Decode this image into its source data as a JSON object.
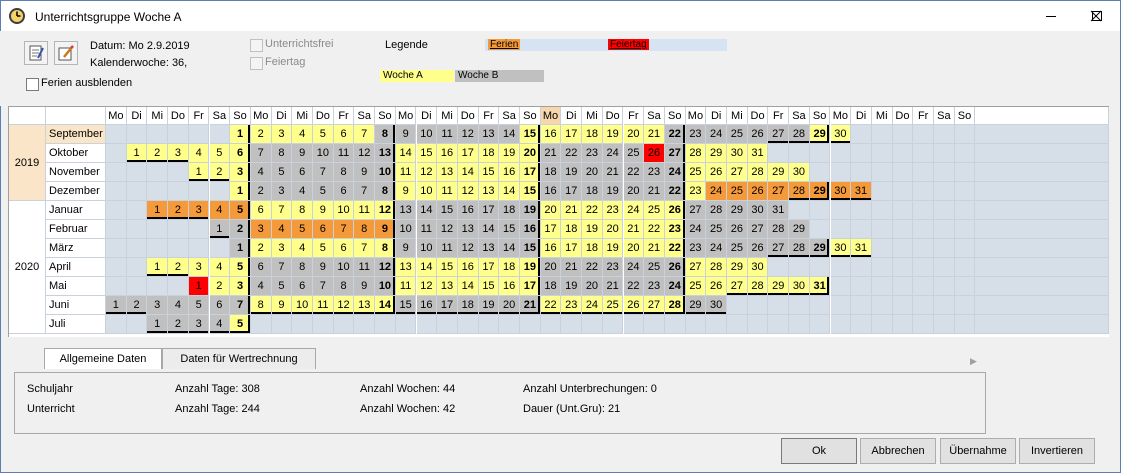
{
  "window": {
    "title": "Unterrichtsgruppe Woche A"
  },
  "header": {
    "date_label": "Datum: Mo 2.9.2019",
    "week_label": "Kalenderwoche: 36,",
    "hide_holidays_label": "Ferien ausblenden",
    "no_class_label": "Unterrichtsfrei",
    "holiday_label": "Feiertag",
    "legend_label": "Legende",
    "legend_ferien": "Ferien",
    "legend_feiertag": "Feiertag",
    "legend_woche_a": "Woche A",
    "legend_woche_b": "Woche B"
  },
  "calendar": {
    "day_headers": [
      "Mo",
      "Di",
      "Mi",
      "Do",
      "Fr",
      "Sa",
      "So",
      "Mo",
      "Di",
      "Mi",
      "Do",
      "Fr",
      "Sa",
      "So",
      "Mo",
      "Di",
      "Mi",
      "Do",
      "Fr",
      "Sa",
      "So",
      "Mo",
      "Di",
      "Mi",
      "Do",
      "Fr",
      "Sa",
      "So",
      "Mo",
      "Di",
      "Mi",
      "Do",
      "Fr",
      "Sa",
      "So",
      "Mo",
      "Di",
      "Mi",
      "Do",
      "Fr",
      "Sa",
      "So"
    ],
    "years": [
      {
        "label": "2019",
        "span": 4
      },
      {
        "label": "2020",
        "span": 7
      }
    ],
    "months": [
      {
        "name": "September",
        "start": 6,
        "days": 30,
        "types": "YYYYYYYGGGGGGGYYYYYYYGGGGGGGYY"
      },
      {
        "name": "Oktober",
        "start": 1,
        "days": 31,
        "types": "YYYYYYGGGGGGGYYYYYYYGGGGGFGYYYY"
      },
      {
        "name": "November",
        "start": 4,
        "days": 30,
        "types": "YYYGGGGGGGYYYYYYYGGGGGGGYYYYYY"
      },
      {
        "name": "Dezember",
        "start": 6,
        "days": 31,
        "types": "YGGGGGGGYYYYYYYGGGGGGGYOOOOOOOO"
      },
      {
        "name": "Januar",
        "start": 2,
        "days": 31,
        "types": "OOOOOYYYYYYYGGGGGGGYYYYYYYGGGGG"
      },
      {
        "name": "Februar",
        "start": 5,
        "days": 29,
        "types": "GGOOOOOOOGGGGGGGYYYYYYYGGGGGG"
      },
      {
        "name": "März",
        "start": 6,
        "days": 31,
        "types": "GYYYYYYYGGGGGGGYYYYYYYGGGGGGGYY"
      },
      {
        "name": "April",
        "start": 2,
        "days": 30,
        "types": "YYYYYGGGGGGGYYYYYYYGGGGGGGYYYY"
      },
      {
        "name": "Mai",
        "start": 4,
        "days": 31,
        "types": "FYYGGGGGGGYYYYYYYGGGGGGGYYYYYYY"
      },
      {
        "name": "Juni",
        "start": 0,
        "days": 30,
        "types": "GGGGGGGYYYYYYYGGGGGGGYYYYYYYGG"
      },
      {
        "name": "Juli",
        "start": 2,
        "days": 5,
        "types": "GGGGY"
      }
    ]
  },
  "tabs": [
    {
      "label": "Allgemeine Daten"
    },
    {
      "label": "Daten für Wertrechnung"
    }
  ],
  "stats": {
    "row1": {
      "name": "Schuljahr",
      "tage": "Anzahl Tage: 308",
      "wochen": "Anzahl Wochen: 44",
      "extra": "Anzahl Unterbrechungen: 0"
    },
    "row2": {
      "name": "Unterricht",
      "tage": "Anzahl Tage: 244",
      "wochen": "Anzahl Wochen: 42",
      "extra": "Dauer (Unt.Gru): 21"
    }
  },
  "buttons": {
    "ok": "Ok",
    "cancel": "Abbrechen",
    "apply": "Übernahme",
    "invert": "Invertieren"
  },
  "colors": {
    "woche_a": "#ffff8c",
    "woche_b": "#c0c0c0",
    "ferien": "#f59a3a",
    "feiertag": "#ff0000",
    "empty": "#d6dee7"
  }
}
